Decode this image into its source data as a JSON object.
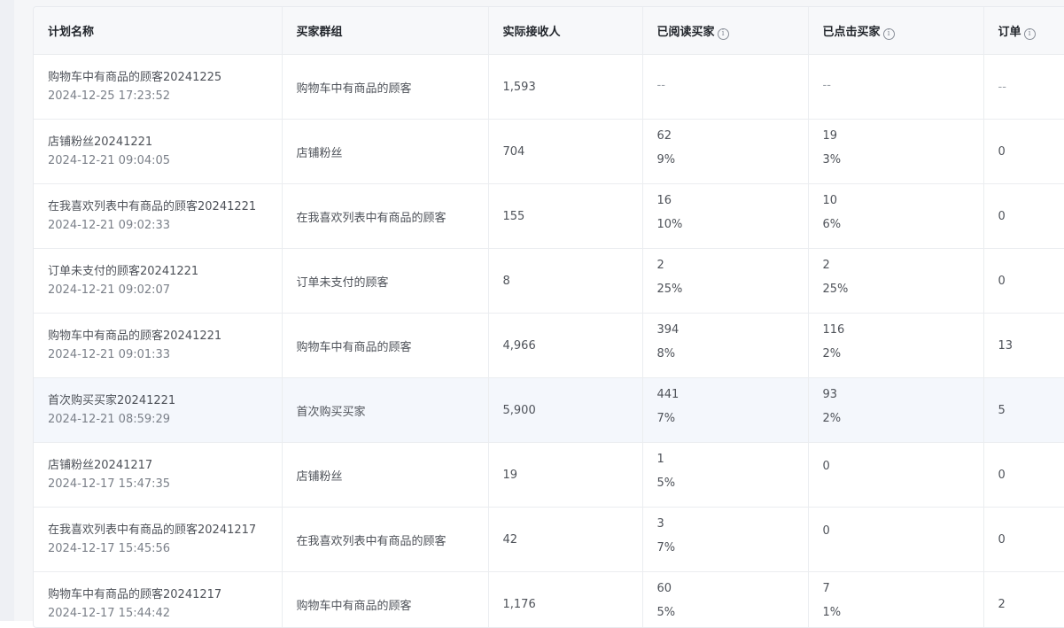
{
  "columns": [
    {
      "label": "计划名称",
      "info": false
    },
    {
      "label": "买家群组",
      "info": false
    },
    {
      "label": "实际接收人",
      "info": false
    },
    {
      "label": "已阅读买家",
      "info": true
    },
    {
      "label": "已点击买家",
      "info": true
    },
    {
      "label": "订单",
      "info": true
    }
  ],
  "info_icon_glyph": "i",
  "rows": [
    {
      "name": "购物车中有商品的顾客20241225",
      "time": "2024-12-25 17:23:52",
      "group": "购物车中有商品的顾客",
      "receivers": "1,593",
      "read": "--",
      "read_pct": "",
      "clicked": "--",
      "clicked_pct": "",
      "orders": "--"
    },
    {
      "name": "店铺粉丝20241221",
      "time": "2024-12-21 09:04:05",
      "group": "店铺粉丝",
      "receivers": "704",
      "read": "62",
      "read_pct": "9%",
      "clicked": "19",
      "clicked_pct": "3%",
      "orders": "0"
    },
    {
      "name": "在我喜欢列表中有商品的顾客20241221",
      "time": "2024-12-21 09:02:33",
      "group": "在我喜欢列表中有商品的顾客",
      "receivers": "155",
      "read": "16",
      "read_pct": "10%",
      "clicked": "10",
      "clicked_pct": "6%",
      "orders": "0"
    },
    {
      "name": "订单未支付的顾客20241221",
      "time": "2024-12-21 09:02:07",
      "group": "订单未支付的顾客",
      "receivers": "8",
      "read": "2",
      "read_pct": "25%",
      "clicked": "2",
      "clicked_pct": "25%",
      "orders": "0"
    },
    {
      "name": "购物车中有商品的顾客20241221",
      "time": "2024-12-21 09:01:33",
      "group": "购物车中有商品的顾客",
      "receivers": "4,966",
      "read": "394",
      "read_pct": "8%",
      "clicked": "116",
      "clicked_pct": "2%",
      "orders": "13"
    },
    {
      "name": "首次购买买家20241221",
      "time": "2024-12-21 08:59:29",
      "group": "首次购买买家",
      "receivers": "5,900",
      "read": "441",
      "read_pct": "7%",
      "clicked": "93",
      "clicked_pct": "2%",
      "orders": "5",
      "highlighted": true
    },
    {
      "name": "店铺粉丝20241217",
      "time": "2024-12-17 15:47:35",
      "group": "店铺粉丝",
      "receivers": "19",
      "read": "1",
      "read_pct": "5%",
      "clicked": "0",
      "clicked_pct": "",
      "orders": "0"
    },
    {
      "name": "在我喜欢列表中有商品的顾客20241217",
      "time": "2024-12-17 15:45:56",
      "group": "在我喜欢列表中有商品的顾客",
      "receivers": "42",
      "read": "3",
      "read_pct": "7%",
      "clicked": "0",
      "clicked_pct": "",
      "orders": "0"
    },
    {
      "name": "购物车中有商品的顾客20241217",
      "time": "2024-12-17 15:44:42",
      "group": "购物车中有商品的顾客",
      "receivers": "1,176",
      "read": "60",
      "read_pct": "5%",
      "clicked": "7",
      "clicked_pct": "1%",
      "orders": "2"
    }
  ]
}
